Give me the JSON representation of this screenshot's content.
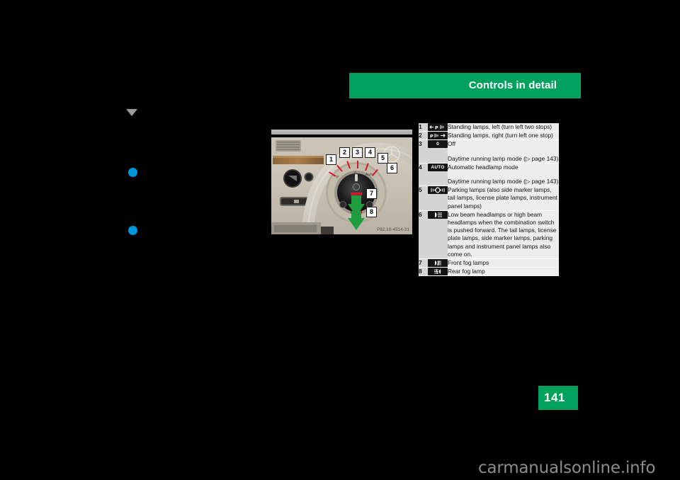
{
  "header": {
    "title": "Controls in detail"
  },
  "figure": {
    "caption": "P82.10-4514-31",
    "alt_name": "light-switch-photo",
    "callouts": [
      "1",
      "2",
      "3",
      "4",
      "5",
      "6",
      "7",
      "8"
    ]
  },
  "legend": {
    "rows": [
      {
        "num": "1",
        "icon": "standing-lamps-left-icon",
        "icon_text": "",
        "paragraphs": [
          "Standing lamps, left (turn left two stops)"
        ]
      },
      {
        "num": "2",
        "icon": "standing-lamps-right-icon",
        "icon_text": "",
        "paragraphs": [
          "Standing lamps, right (turn left one stop)"
        ]
      },
      {
        "num": "3",
        "icon": "off-icon",
        "icon_text": "0",
        "paragraphs": [
          "Off",
          "Daytime running lamp mode (▷ page 143)"
        ]
      },
      {
        "num": "4",
        "icon": "auto-headlamp-icon",
        "icon_text": "AUTO",
        "paragraphs": [
          "Automatic headlamp mode",
          "Daytime running lamp mode (▷ page 143)"
        ]
      },
      {
        "num": "5",
        "icon": "parking-lamps-icon",
        "icon_text": "",
        "paragraphs": [
          "Parking lamps (also side marker lamps, tail lamps, license plate lamps, instrument panel lamps)"
        ]
      },
      {
        "num": "6",
        "icon": "low-beam-headlamps-icon",
        "icon_text": "",
        "paragraphs": [
          "Low beam headlamps or high beam headlamps when the combination switch is pushed forward. The tail lamps, license plate lamps, side marker lamps, parking lamps and instrument panel lamps also come on."
        ]
      },
      {
        "num": "7",
        "icon": "front-fog-lamps-icon",
        "icon_text": "",
        "paragraphs": [
          "Front fog lamps"
        ]
      },
      {
        "num": "8",
        "icon": "rear-fog-lamp-icon",
        "icon_text": "",
        "paragraphs": [
          "Rear fog lamp"
        ]
      }
    ]
  },
  "footer": {
    "page_number": "141",
    "watermark": "carmanualsonline.info"
  },
  "colors": {
    "brand_green": "#00a15d",
    "bullet_blue": "#0096dc",
    "marker_gray": "#9a9a9a",
    "table_label_bg": "#d4d4d4",
    "table_desc_bg": "#ededed",
    "callout_red": "#d8172a"
  }
}
